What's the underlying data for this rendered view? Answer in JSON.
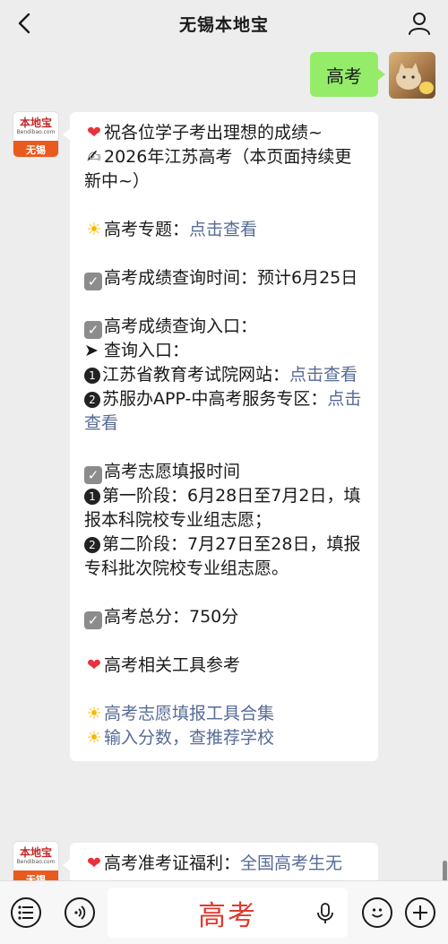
{
  "header": {
    "title": "无锡本地宝",
    "back_icon": "chevron-left-icon",
    "user_icon": "user-icon"
  },
  "outgoing": {
    "text": "高考"
  },
  "brand": {
    "name": "本地宝",
    "domain": "Bendibao.com",
    "city": "无锡"
  },
  "message": {
    "line1": "祝各位学子考出理想的成绩~",
    "line2": "2026年江苏高考（本页面持续更新中~）",
    "topic_label": "高考专题：",
    "topic_link": "点击查看",
    "query_time": "高考成绩查询时间：预计6月25日",
    "query_entry": "高考成绩查询入口：",
    "arrow_label": "➤ 查询入口：",
    "entry1_label": "江苏省教育考试院网站：",
    "entry1_link": "点击查看",
    "entry2_label": "苏服办APP-中高考服务专区：",
    "entry2_link": "点击查看",
    "apply_title": "高考志愿填报时间",
    "phase1": "第一阶段：6月28日至7月2日，填报本科院校专业组志愿；",
    "phase2": "第二阶段：7月27日至28日，填报专科批次院校专业组志愿。",
    "total_score": "高考总分：750分",
    "tools_title": "高考相关工具参考",
    "tool1": "高考志愿填报工具合集",
    "tool2": "输入分数，查推荐学校"
  },
  "second_message": {
    "label": "高考准考证福利：",
    "link": "全国高考生无"
  },
  "input": {
    "text": "高考"
  },
  "colors": {
    "chat_bg": "#ededed",
    "outgoing_bubble": "#95ec69",
    "link": "#576b95",
    "input_text": "#e03a2f"
  }
}
